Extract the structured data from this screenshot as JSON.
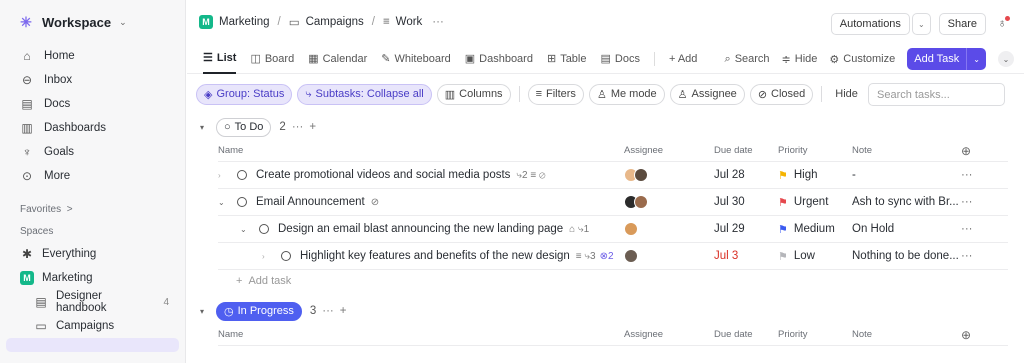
{
  "workspace": {
    "name": "Workspace",
    "chevron": "⌄"
  },
  "sidebar": {
    "nav": [
      {
        "label": "Home",
        "icon": "home-icon",
        "glyph": "⌂"
      },
      {
        "label": "Inbox",
        "icon": "inbox-icon",
        "glyph": "⊖"
      },
      {
        "label": "Docs",
        "icon": "docs-icon",
        "glyph": "▤"
      },
      {
        "label": "Dashboards",
        "icon": "dashboard-icon",
        "glyph": "▥"
      },
      {
        "label": "Goals",
        "icon": "trophy-icon",
        "glyph": "♆"
      },
      {
        "label": "More",
        "icon": "more-icon",
        "glyph": "⊙"
      }
    ],
    "favorites_label": "Favorites",
    "favorites_arrow": ">",
    "spaces_label": "Spaces",
    "everything_label": "Everything",
    "space_name": "Marketing",
    "space_badge": "M",
    "children": [
      {
        "label": "Designer handbook",
        "count": "4",
        "icon": "doc-icon",
        "glyph": "▤"
      },
      {
        "label": "Campaigns",
        "count": "",
        "icon": "folder-icon",
        "glyph": "▭"
      }
    ]
  },
  "breadcrumb": {
    "space_badge": "M",
    "space": "Marketing",
    "sep": "/",
    "folder": "Campaigns",
    "list": "Work",
    "dots": "···"
  },
  "topbar": {
    "automations": "Automations",
    "automations_chevron": "⌄",
    "share": "Share"
  },
  "views": {
    "tabs": [
      {
        "label": "List",
        "glyph": "☰",
        "active": true
      },
      {
        "label": "Board",
        "glyph": "◫"
      },
      {
        "label": "Calendar",
        "glyph": "▦"
      },
      {
        "label": "Whiteboard",
        "glyph": "✎"
      },
      {
        "label": "Dashboard",
        "glyph": "▣"
      },
      {
        "label": "Table",
        "glyph": "⊞"
      },
      {
        "label": "Docs",
        "glyph": "▤"
      }
    ],
    "add": "+ Add",
    "search": "Search",
    "hide": "Hide",
    "customize": "Customize",
    "add_task": "Add Task",
    "add_task_arrow": "⌄",
    "collapse_arrow": "⌄"
  },
  "filters": {
    "group": "Group: Status",
    "subtasks": "Subtasks: Collapse all",
    "columns": "Columns",
    "filters": "Filters",
    "me_mode": "Me mode",
    "assignee": "Assignee",
    "closed": "Closed",
    "hide": "Hide",
    "search_placeholder": "Search tasks..."
  },
  "columns": {
    "name": "Name",
    "assignee": "Assignee",
    "due": "Due date",
    "priority": "Priority",
    "note": "Note",
    "add": "⊕"
  },
  "groups": [
    {
      "status": "To Do",
      "count": "2",
      "dots": "···",
      "plus": "+",
      "tasks": [
        {
          "name": "Create promotional videos and social media posts",
          "meta": "⤷2 ≡ ⊘",
          "due": "Jul 28",
          "priority": "High",
          "priority_color": "#f5b400",
          "note": "-",
          "level": 0,
          "caret": "›",
          "avatars": [
            "#e8b88a",
            "#5b4b3e"
          ]
        },
        {
          "name": "Email Announcement",
          "meta": "⊘",
          "due": "Jul 30",
          "priority": "Urgent",
          "priority_color": "#e5484d",
          "note": "Ash to sync with Br...",
          "level": 0,
          "caret": "⌄",
          "avatars": [
            "#2b2b2b",
            "#9a6b4c"
          ]
        },
        {
          "name": "Design an email blast announcing the new landing page",
          "meta": "⌂ ⤷1",
          "due": "Jul 29",
          "priority": "Medium",
          "priority_color": "#3b5bf0",
          "note": "On Hold",
          "level": 1,
          "caret": "⌄",
          "avatars": [
            "#d99a5a"
          ]
        },
        {
          "name": "Highlight key features and benefits of the new design",
          "meta": "≡ ⤷3",
          "meta_extra": "⊗2",
          "due": "Jul 3",
          "due_color": "#d93025",
          "priority": "Low",
          "priority_color": "#b5b6ba",
          "note": "Nothing to be done...",
          "level": 2,
          "caret": "›",
          "avatars": [
            "#6b5d52"
          ]
        }
      ],
      "add_task": "Add task"
    },
    {
      "status": "In Progress",
      "count": "3",
      "dots": "···",
      "plus": "+"
    }
  ],
  "more": "···"
}
